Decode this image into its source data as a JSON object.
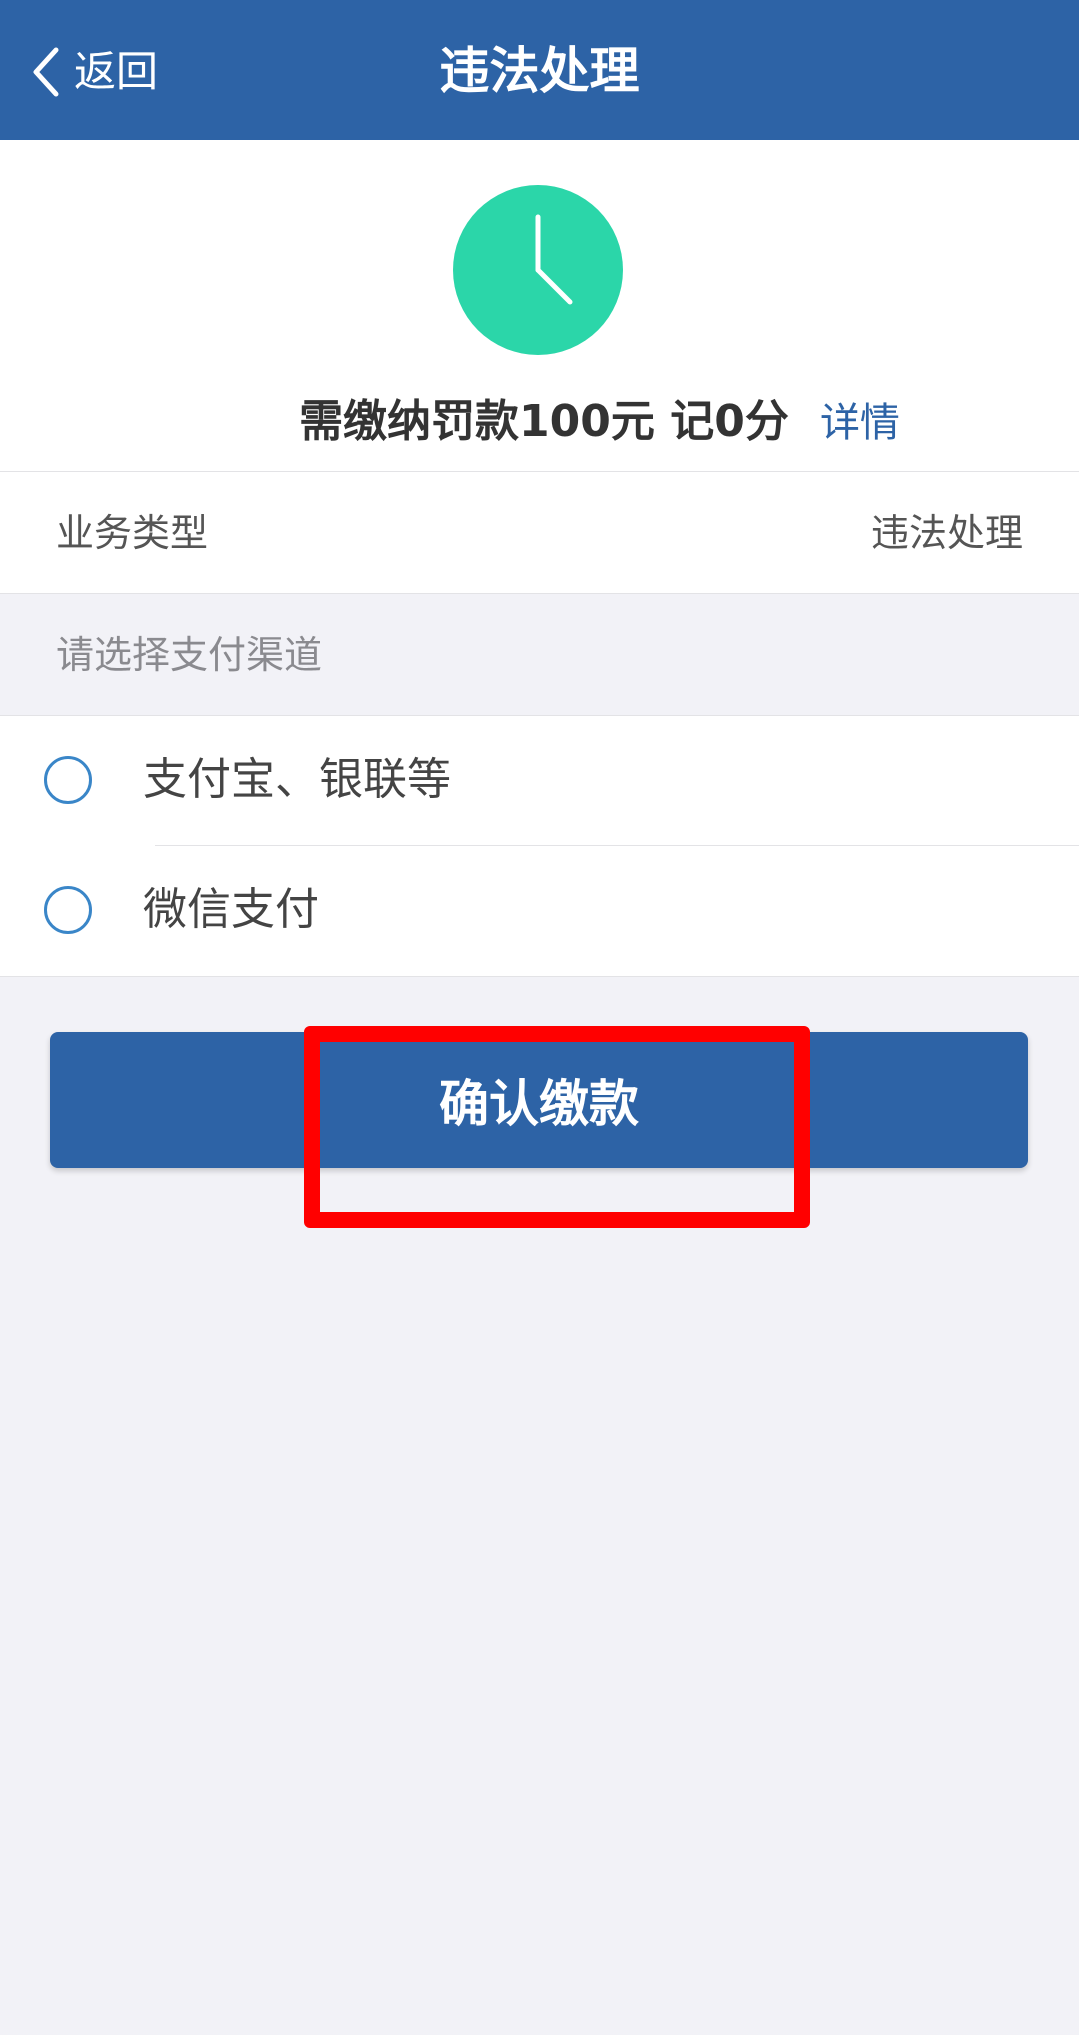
{
  "nav": {
    "back_label": "返回",
    "title": "违法处理"
  },
  "summary": {
    "fine_text": "需缴纳罚款100元 记0分",
    "details_link": "详情",
    "icon": "clock-icon",
    "icon_color": "#2bd6a9"
  },
  "business": {
    "label": "业务类型",
    "value": "违法处理"
  },
  "payment": {
    "section_header": "请选择支付渠道",
    "options": [
      {
        "label": "支付宝、银联等"
      },
      {
        "label": "微信支付"
      }
    ]
  },
  "confirm": {
    "label": "确认缴款"
  },
  "colors": {
    "accent": "#2d63a6",
    "radio": "#3a86c8",
    "highlight": "#ff0000"
  }
}
